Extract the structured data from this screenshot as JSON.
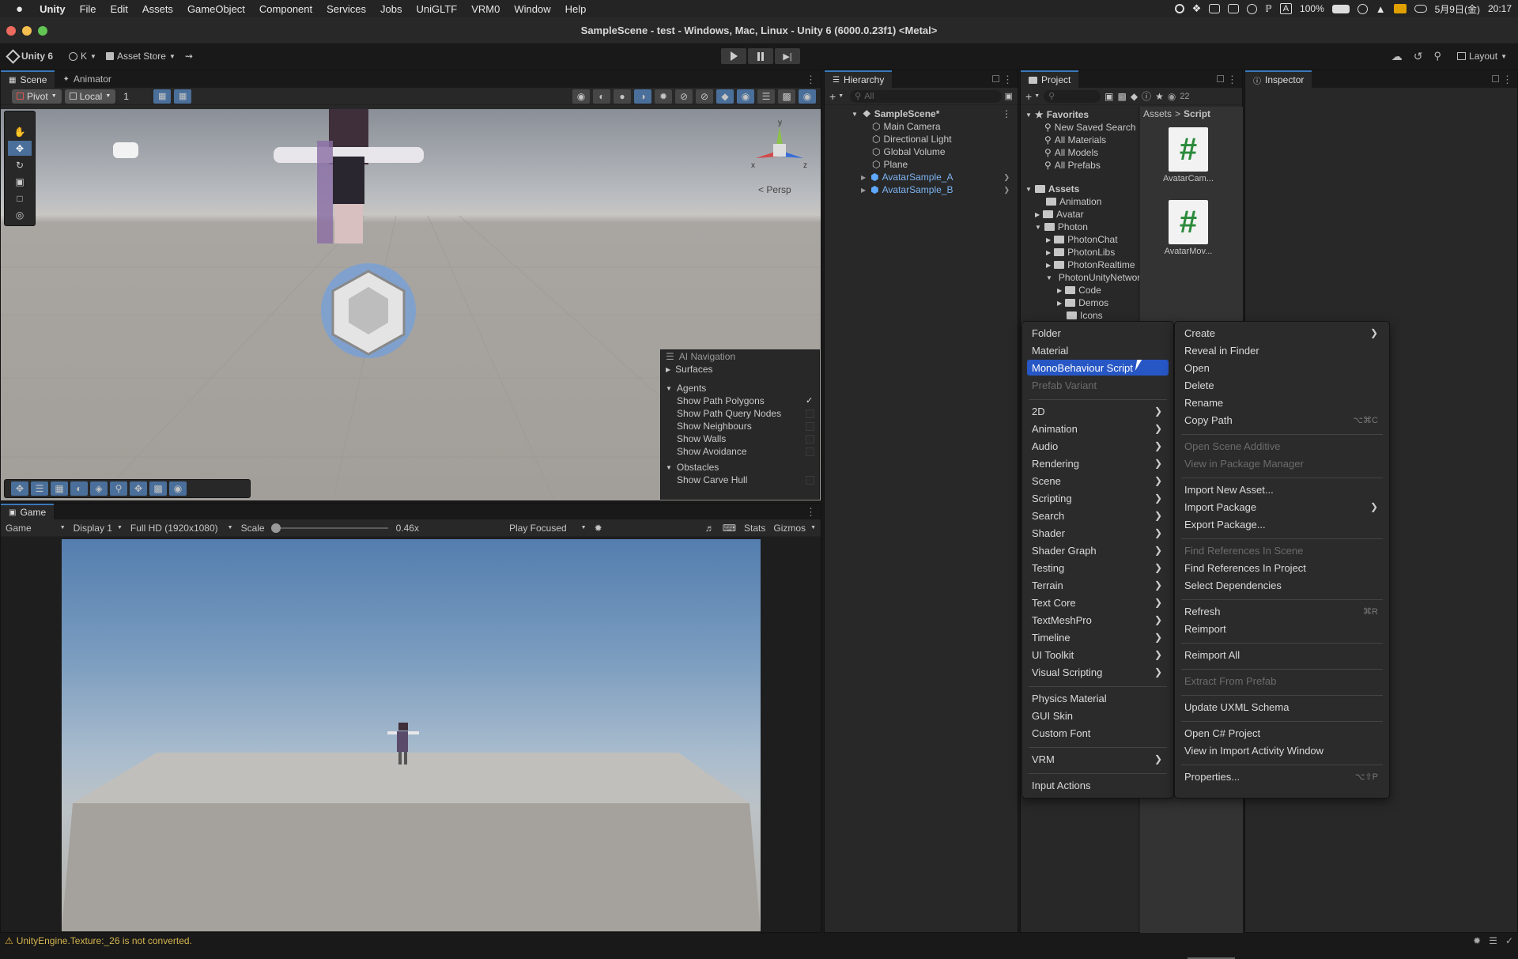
{
  "menubar": {
    "app": "Unity",
    "items": [
      "File",
      "Edit",
      "Assets",
      "GameObject",
      "Component",
      "Services",
      "Jobs",
      "UniGLTF",
      "VRM0",
      "Window",
      "Help"
    ],
    "battery": "100%",
    "ime": "A",
    "date": "5月9日(金)",
    "time": "20:17"
  },
  "window": {
    "title": "SampleScene - test - Windows, Mac, Linux - Unity 6 (6000.0.23f1) <Metal>"
  },
  "toolbar": {
    "unity_label": "Unity 6",
    "account_label": "K",
    "asset_store_label": "Asset Store",
    "layout_label": "Layout"
  },
  "scene_panel": {
    "tabs": [
      "Scene",
      "Animator"
    ],
    "pivot_label": "Pivot",
    "local_label": "Local",
    "snap_value": "1",
    "persp_label": "< Persp",
    "gizmo_axes": [
      "y",
      "x",
      "z"
    ]
  },
  "ai_nav": {
    "title": "AI Navigation",
    "surfaces_label": "Surfaces",
    "agents_label": "Agents",
    "agent_options": [
      {
        "label": "Show Path Polygons",
        "checked": true
      },
      {
        "label": "Show Path Query Nodes",
        "checked": false
      },
      {
        "label": "Show Neighbours",
        "checked": false
      },
      {
        "label": "Show Walls",
        "checked": false
      },
      {
        "label": "Show Avoidance",
        "checked": false
      }
    ],
    "obstacles_label": "Obstacles",
    "obstacle_options": [
      {
        "label": "Show Carve Hull",
        "checked": false
      }
    ]
  },
  "game_panel": {
    "tab": "Game",
    "mode": "Game",
    "display": "Display 1",
    "resolution": "Full HD (1920x1080)",
    "scale_label": "Scale",
    "scale_value": "0.46x",
    "scale_fraction": 0.03,
    "play_focused": "Play Focused",
    "stats_label": "Stats",
    "gizmos_label": "Gizmos"
  },
  "hierarchy": {
    "tab": "Hierarchy",
    "search_placeholder": "All",
    "scene_name": "SampleScene*",
    "items": [
      "Main Camera",
      "Directional Light",
      "Global Volume",
      "Plane",
      "AvatarSample_A",
      "AvatarSample_B"
    ]
  },
  "project": {
    "tab": "Project",
    "count": "22",
    "favorites_label": "Favorites",
    "favorites": [
      "New Saved Search",
      "All Materials",
      "All Models",
      "All Prefabs"
    ],
    "assets_label": "Assets",
    "assets_tree": [
      "Animation",
      "Avatar",
      "Photon",
      "PhotonChat",
      "PhotonLibs",
      "PhotonRealtime",
      "PhotonUnityNetworking",
      "Code",
      "Demos",
      "Icons"
    ],
    "breadcrumb": [
      "Assets",
      "Script"
    ],
    "files": [
      "AvatarCam...",
      "AvatarMov..."
    ],
    "file_icon_glyph": "#"
  },
  "inspector": {
    "tab": "Inspector"
  },
  "create_menu": {
    "items": [
      {
        "label": "Folder"
      },
      {
        "label": "Material"
      },
      {
        "label": "MonoBehaviour Script"
      },
      {
        "label": "Prefab Variant",
        "disabled": true
      },
      {
        "label": "2D",
        "submenu": true
      },
      {
        "label": "Animation",
        "submenu": true
      },
      {
        "label": "Audio",
        "submenu": true
      },
      {
        "label": "Rendering",
        "submenu": true
      },
      {
        "label": "Scene",
        "submenu": true
      },
      {
        "label": "Scripting",
        "submenu": true
      },
      {
        "label": "Search",
        "submenu": true
      },
      {
        "label": "Shader",
        "submenu": true
      },
      {
        "label": "Shader Graph",
        "submenu": true
      },
      {
        "label": "Testing",
        "submenu": true
      },
      {
        "label": "Terrain",
        "submenu": true
      },
      {
        "label": "Text Core",
        "submenu": true
      },
      {
        "label": "TextMeshPro",
        "submenu": true
      },
      {
        "label": "Timeline",
        "submenu": true
      },
      {
        "label": "UI Toolkit",
        "submenu": true
      },
      {
        "label": "Visual Scripting",
        "submenu": true
      },
      {
        "label": "Physics Material"
      },
      {
        "label": "GUI Skin"
      },
      {
        "label": "Custom Font"
      },
      {
        "label": "VRM",
        "submenu": true
      },
      {
        "label": "Input Actions"
      }
    ]
  },
  "assets_menu": {
    "items": [
      {
        "label": "Create",
        "submenu": true
      },
      {
        "label": "Reveal in Finder"
      },
      {
        "label": "Open"
      },
      {
        "label": "Delete"
      },
      {
        "label": "Rename"
      },
      {
        "label": "Copy Path",
        "shortcut": "⌥⌘C"
      },
      {
        "label": "Open Scene Additive",
        "disabled": true
      },
      {
        "label": "View in Package Manager",
        "disabled": true
      },
      {
        "label": "Import New Asset..."
      },
      {
        "label": "Import Package",
        "submenu": true
      },
      {
        "label": "Export Package..."
      },
      {
        "label": "Find References In Scene",
        "disabled": true
      },
      {
        "label": "Find References In Project"
      },
      {
        "label": "Select Dependencies"
      },
      {
        "label": "Refresh",
        "shortcut": "⌘R"
      },
      {
        "label": "Reimport"
      },
      {
        "label": "Reimport All"
      },
      {
        "label": "Extract From Prefab",
        "disabled": true
      },
      {
        "label": "Update UXML Schema"
      },
      {
        "label": "Open C# Project"
      },
      {
        "label": "View in Import Activity Window"
      },
      {
        "label": "Properties...",
        "shortcut": "⌥⇧P"
      }
    ]
  },
  "statusbar": {
    "message": "UnityEngine.Texture:_26 is not converted."
  },
  "colors": {
    "accent": "#3a79bb",
    "menu_highlight": "#2757c5",
    "warning": "#d2b450"
  }
}
